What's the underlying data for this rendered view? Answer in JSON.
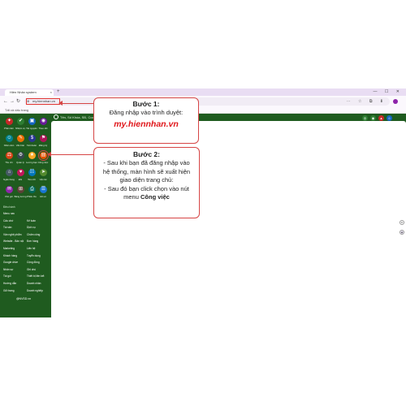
{
  "browser": {
    "tab_title": "Hiền Nhân system",
    "new_tab": "+",
    "tab_close": "×",
    "window_controls": "— ☐ ✕",
    "url": "my.hiennhan.vn",
    "bookmark": "Tất cả dấu trang",
    "toolbar_icons": "⋯ ☆ ⧉ ⬇"
  },
  "app": {
    "search_placeholder": "Tên, Số Khóa, SĐ, Code, Email...",
    "grid_items": [
      {
        "label": "Phân tâm",
        "color": "#c62828",
        "glyph": "✦"
      },
      {
        "label": "Nhiệm vụ",
        "color": "#2e7d32",
        "glyph": "✔"
      },
      {
        "label": "Tài nguyên",
        "color": "#1565c0",
        "glyph": "▣"
      },
      {
        "label": "Theo dõi",
        "color": "#6a1b9a",
        "glyph": "◉"
      },
      {
        "label": "Nhân viên",
        "color": "#00838f",
        "glyph": "☺"
      },
      {
        "label": "Văn bản",
        "color": "#ef6c00",
        "glyph": "✎"
      },
      {
        "label": "Tài khoản",
        "color": "#283593",
        "glyph": "$"
      },
      {
        "label": "Đăng ký",
        "color": "#ad1457",
        "glyph": "⚑"
      },
      {
        "label": "Thu chi",
        "color": "#d84315",
        "glyph": "⚖"
      },
      {
        "label": "Quản lý",
        "color": "#37474f",
        "glyph": "⚙"
      },
      {
        "label": "Lương bạn",
        "color": "#f9a825",
        "glyph": "★"
      },
      {
        "label": "Công việc",
        "color": "#e65100",
        "glyph": "▤"
      },
      {
        "label": "Ngân hàng",
        "color": "#455a64",
        "glyph": "⌂"
      },
      {
        "label": "Đối",
        "color": "#c2185b",
        "glyph": "♥"
      },
      {
        "label": "Tiêu chí",
        "color": "#0277bd",
        "glyph": "☷"
      },
      {
        "label": "Vận tải",
        "color": "#558b2f",
        "glyph": "➤"
      },
      {
        "label": "Khó gói",
        "color": "#8e24aa",
        "glyph": "✉"
      },
      {
        "label": "Bảng lương",
        "color": "#5d4037",
        "glyph": "⊞"
      },
      {
        "label": "Phiếu thu",
        "color": "#00695c",
        "glyph": "⎙"
      },
      {
        "label": "Hồ sơ",
        "color": "#1976d2",
        "glyph": "☰"
      }
    ],
    "menu_header": "Điều hành",
    "menu_left": [
      "Menu nav",
      "Cấu chứ",
      "Tài sản",
      "Vận nghệ phẩm",
      "Website - Bản nội",
      "Marketing",
      "Khách hàng",
      "Google drive",
      "Nhân sự",
      "Tài gói",
      "Hướng dẫn",
      "Gửi trang"
    ],
    "menu_right": [
      "",
      "Kế toán",
      "Dịch vụ",
      "Chấm công",
      "Đơn hàng",
      "Liên hệ",
      "Tuyển dụng",
      "Cộng đồng",
      "Ghi chú",
      "Thiết bị liên kết",
      "Doanh nhân",
      "Doanh nghiệp"
    ],
    "footer": "@NVSD.vn"
  },
  "callout1": {
    "title": "Bước 1:",
    "text": "Đăng nhập vào trình duyệt:",
    "url": "my.hiennhan.vn"
  },
  "callout2": {
    "title": "Bước 2:",
    "line1": "- Sau khi bạn đã đăng nhập vào",
    "line2": "hệ thống, màn hình sẽ xuất hiện",
    "line3": "giao diện trang chủ:",
    "line4": "- Sau đó bạn click chọn vào nút",
    "line5_prefix": "menu ",
    "line5_bold": "Công việc"
  },
  "colors": {
    "sidebar": "#1f5b1f",
    "callout_border": "#d64545",
    "url_red": "#e0171b"
  }
}
